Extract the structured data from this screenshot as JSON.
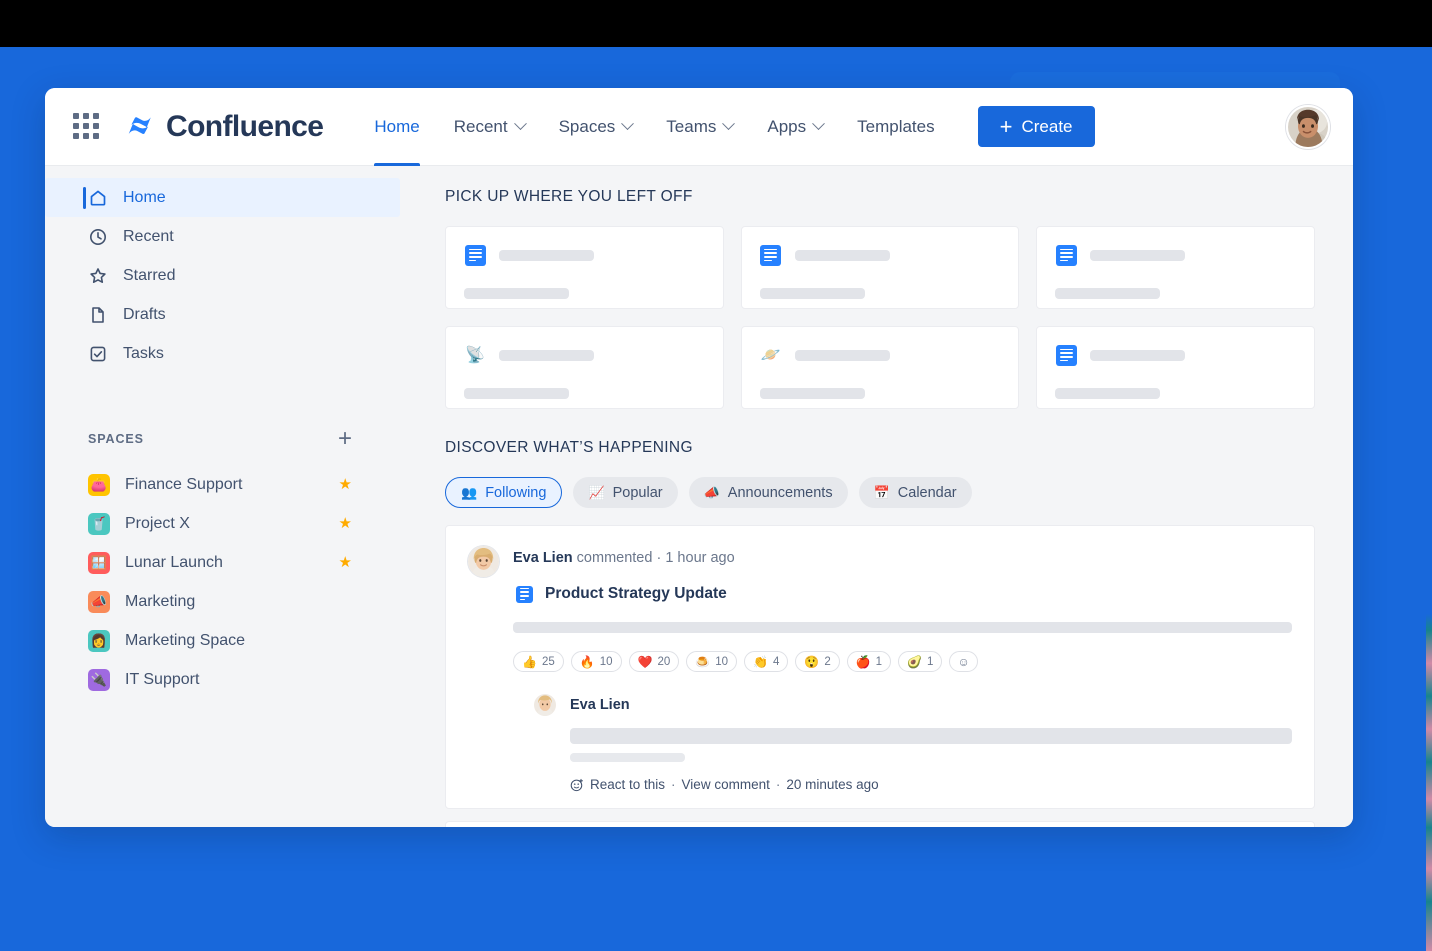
{
  "colors": {
    "brand_blue": "#1868db",
    "page_bg": "#f4f5f7",
    "text_dark": "#253858",
    "text_muted": "#6b778c",
    "star_gold": "#ffab00",
    "black_band": "#000000"
  },
  "header": {
    "app_switcher_icon": "grid-apps-icon",
    "brand_name": "Confluence",
    "nav": [
      {
        "label": "Home",
        "has_caret": false,
        "active": true
      },
      {
        "label": "Recent",
        "has_caret": true,
        "active": false
      },
      {
        "label": "Spaces",
        "has_caret": true,
        "active": false
      },
      {
        "label": "Teams",
        "has_caret": true,
        "active": false
      },
      {
        "label": "Apps",
        "has_caret": true,
        "active": false
      },
      {
        "label": "Templates",
        "has_caret": false,
        "active": false
      }
    ],
    "create_button": {
      "label": "Create",
      "plus": "+"
    },
    "avatar": "user-avatar"
  },
  "sidebar": {
    "items": [
      {
        "label": "Home",
        "icon": "home-icon",
        "active": true
      },
      {
        "label": "Recent",
        "icon": "clock-icon",
        "active": false
      },
      {
        "label": "Starred",
        "icon": "star-outline-icon",
        "active": false
      },
      {
        "label": "Drafts",
        "icon": "page-icon",
        "active": false
      },
      {
        "label": "Tasks",
        "icon": "checkbox-icon",
        "active": false
      }
    ],
    "spaces_header": {
      "title": "SPACES",
      "add_label": "+"
    },
    "spaces": [
      {
        "name": "Finance Support",
        "emoji": "👛",
        "bg": "#ffc400",
        "starred": true
      },
      {
        "name": "Project X",
        "emoji": "🥤",
        "bg": "#4bc7c0",
        "starred": true
      },
      {
        "name": "Lunar Launch",
        "emoji": "🪟",
        "bg": "#ff5c5c",
        "starred": true
      },
      {
        "name": "Marketing",
        "emoji": "📣",
        "bg": "#f98b5a",
        "starred": false
      },
      {
        "name": "Marketing Space",
        "emoji": "👩",
        "bg": "#4bc7c0",
        "starred": false
      },
      {
        "name": "IT Support",
        "emoji": "🔌",
        "bg": "#9f6ae0",
        "starred": false
      }
    ],
    "star_glyph": "★"
  },
  "main": {
    "pick_up_title": "PICK UP WHERE YOU LEFT OFF",
    "recent_cards": [
      {
        "icon": "blue-document-icon",
        "emoji": ""
      },
      {
        "icon": "blue-document-icon",
        "emoji": ""
      },
      {
        "icon": "blue-document-icon",
        "emoji": ""
      },
      {
        "icon": "satellite-antenna-icon",
        "emoji": "📡"
      },
      {
        "icon": "ringed-planet-icon",
        "emoji": "🪐"
      },
      {
        "icon": "blue-document-icon",
        "emoji": ""
      }
    ],
    "discover_title": "DISCOVER WHAT’S HAPPENING",
    "tabs": [
      {
        "label": "Following",
        "icon": "people-group-icon",
        "glyph": "👥",
        "active": true
      },
      {
        "label": "Popular",
        "icon": "trend-chart-icon",
        "glyph": "📈",
        "active": false
      },
      {
        "label": "Announcements",
        "icon": "megaphone-icon",
        "glyph": "📣",
        "active": false
      },
      {
        "label": "Calendar",
        "icon": "calendar-icon",
        "glyph": "📅",
        "active": false
      }
    ],
    "feed": {
      "author": "Eva Lien",
      "action": "commented",
      "separator": "·",
      "timestamp": "1 hour ago",
      "page_title": "Product Strategy Update",
      "page_icon": "blue-document-icon",
      "reactions": [
        {
          "emoji": "👍",
          "name": "thumbs-up",
          "count": "25"
        },
        {
          "emoji": "🔥",
          "name": "fire",
          "count": "10"
        },
        {
          "emoji": "❤️",
          "name": "red-heart",
          "count": "20"
        },
        {
          "emoji": "🍮",
          "name": "flan",
          "count": "10"
        },
        {
          "emoji": "👏",
          "name": "clapping-hands",
          "count": "4"
        },
        {
          "emoji": "😲",
          "name": "astonished-face",
          "count": "2"
        },
        {
          "emoji": "🍎",
          "name": "red-apple",
          "count": "1"
        },
        {
          "emoji": "🥑",
          "name": "avocado",
          "count": "1"
        }
      ],
      "add_reaction_glyph": "☺",
      "comment": {
        "author": "Eva Lien",
        "react_label": "React to this",
        "view_label": "View comment",
        "timestamp": "20 minutes ago",
        "separator": "·",
        "react_icon": "add-reaction-icon"
      }
    }
  }
}
